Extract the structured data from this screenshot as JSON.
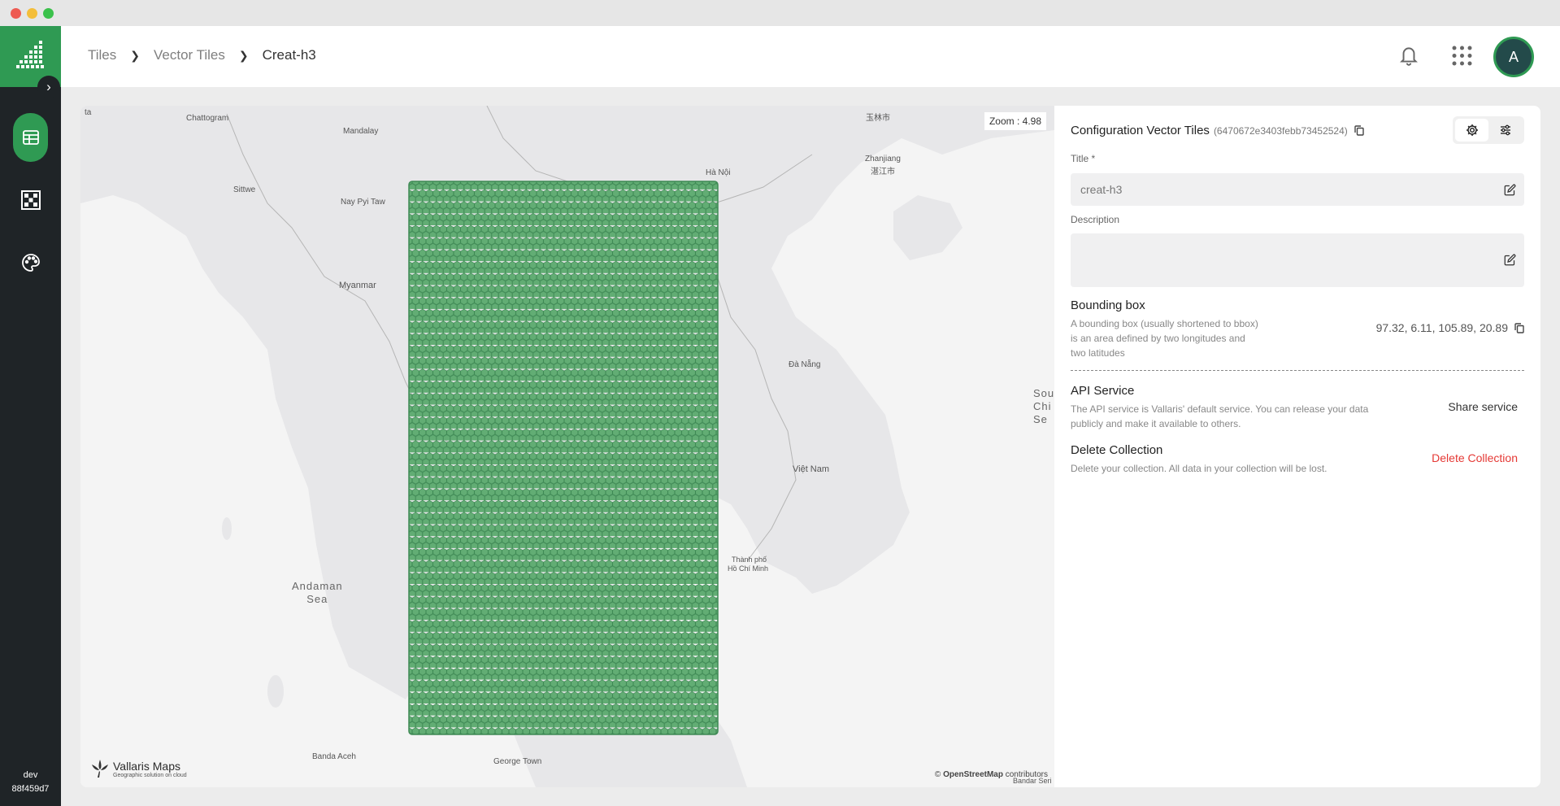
{
  "sidebar": {
    "footer_env": "dev",
    "footer_build": "88f459d7"
  },
  "breadcrumb": {
    "items": [
      "Tiles",
      "Vector Tiles"
    ],
    "current": "Creat-h3"
  },
  "user": {
    "avatar_initial": "A"
  },
  "map": {
    "zoom_text": "Zoom : 4.98",
    "attribution_prefix": "©",
    "attribution_link": "OpenStreetMap",
    "attribution_suffix": "contributors",
    "brand_name": "Vallaris Maps",
    "brand_tagline": "Geographic solution on cloud",
    "overlay_color": "#5aa86e",
    "labels": {
      "chattogram": "Chattogram",
      "mandalay": "Mandalay",
      "sittwe": "Sittwe",
      "naypyitaw": "Nay Pyi Taw",
      "myanmar": "Myanmar",
      "hanoi": "Hà Nội",
      "zhanjiang": "Zhanjiang",
      "zhanjiang_cn": "湛江市",
      "yulin": "玉林市",
      "danang": "Đà Nẵng",
      "vietnam": "Việt Nam",
      "hcm1": "Thành phố",
      "hcm2": "Hồ Chí Minh",
      "andaman1": "Andaman",
      "andaman2": "Sea",
      "bandaaceh": "Banda Aceh",
      "georgetown": "George Town",
      "sea1": "Sou",
      "sea2": "Chi",
      "sea3": "Se",
      "bandarseri": "Bandar Seri",
      "ta": "ta"
    }
  },
  "panel": {
    "title": "Configuration Vector Tiles",
    "collection_id": "(6470672e3403febb73452524)",
    "title_label": "Title *",
    "title_value": "creat-h3",
    "description_label": "Description",
    "description_value": "",
    "bbox_title": "Bounding box",
    "bbox_desc_1": "A bounding box (usually shortened to bbox)",
    "bbox_desc_2": "is an area defined by two longitudes and",
    "bbox_desc_3": "two latitudes",
    "bbox_value": "97.32, 6.11, 105.89, 20.89",
    "api_title": "API Service",
    "api_desc_1": "The API service is Vallaris' default service. You can release your data",
    "api_desc_2": "publicly and make it available to others.",
    "share_label": "Share service",
    "delete_title": "Delete Collection",
    "delete_desc": "Delete your collection. All data in your collection will be lost.",
    "delete_label": "Delete Collection"
  },
  "colors": {
    "brand_green": "#2f9a53",
    "sidebar_bg": "#1f2427",
    "danger": "#e53935"
  }
}
